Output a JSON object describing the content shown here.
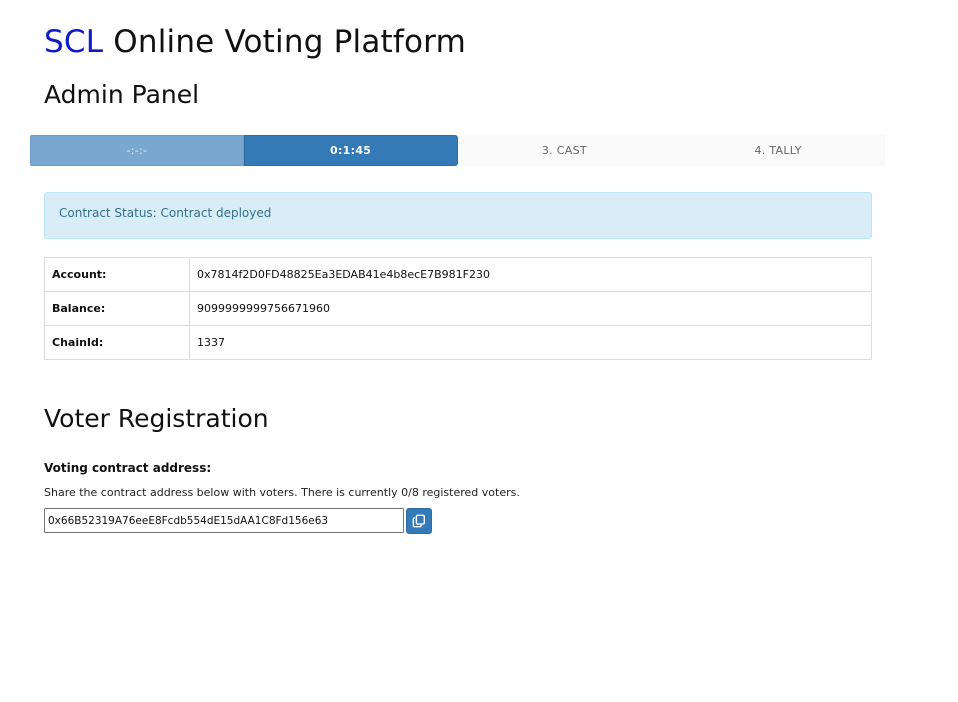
{
  "header": {
    "brand": "SCL",
    "title_rest": "Online Voting Platform",
    "section": "Admin Panel"
  },
  "steps": [
    {
      "label": "-:-:-",
      "state": "done"
    },
    {
      "label": "0:1:45",
      "state": "active"
    },
    {
      "label": "3. CAST",
      "state": "pending"
    },
    {
      "label": "4. TALLY",
      "state": "pending"
    }
  ],
  "status": {
    "text": "Contract Status: Contract deployed"
  },
  "account_table": {
    "rows": [
      {
        "key": "Account:",
        "value": "0x7814f2D0FD48825Ea3EDAB41e4b8ecE7B981F230"
      },
      {
        "key": "Balance:",
        "value": "9099999999756671960"
      },
      {
        "key": "ChainId:",
        "value": "1337"
      }
    ]
  },
  "registration": {
    "title": "Voter Registration",
    "field_label": "Voting contract address:",
    "help_text": "Share the contract address below with voters. There is currently 0/8 registered voters.",
    "contract_address": "0x66B52319A76eeE8Fcdb554dE15dAA1C8Fd156e63",
    "copy_icon": "copy-icon"
  },
  "colors": {
    "brand": "#0d1acc",
    "primary": "#337ab7",
    "info_bg": "#d9edf7",
    "info_text": "#31708f"
  }
}
